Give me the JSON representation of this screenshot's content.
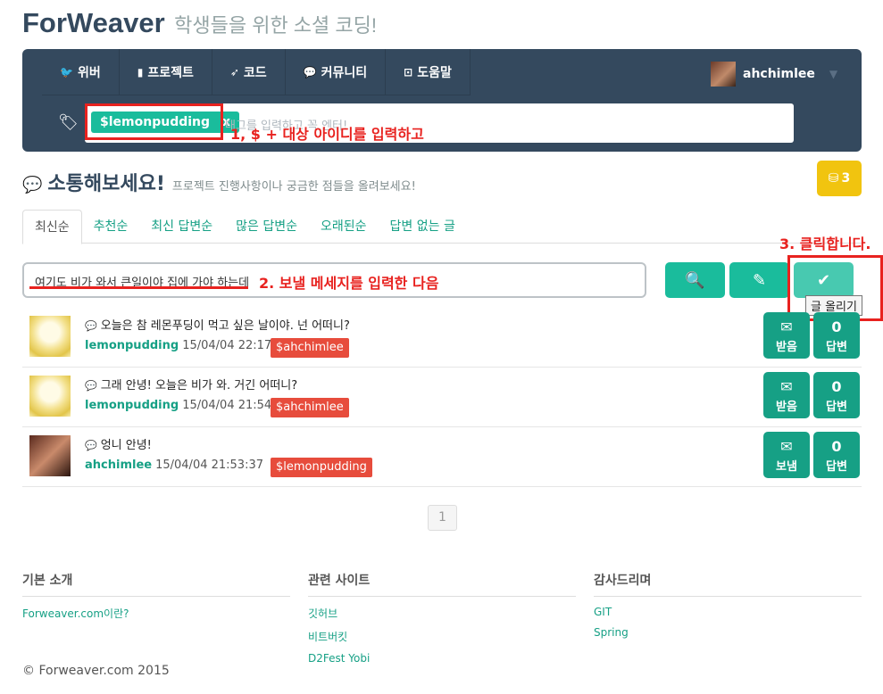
{
  "header": {
    "brand": "ForWeaver",
    "slogan": "학생들을 위한 소셜 코딩!"
  },
  "nav": {
    "items": [
      {
        "icon": "twitter-icon",
        "glyph": "🐦",
        "label": "위버"
      },
      {
        "icon": "bookmark-icon",
        "glyph": "▮",
        "label": "프로젝트"
      },
      {
        "icon": "rocket-icon",
        "glyph": "➶",
        "label": "코드"
      },
      {
        "icon": "comments-icon",
        "glyph": "💬",
        "label": "커뮤니티"
      },
      {
        "icon": "gamepad-icon",
        "glyph": "⊡",
        "label": "도움말"
      }
    ],
    "user": {
      "name": "ahchimlee",
      "caret": "▼"
    }
  },
  "tag_bar": {
    "chip_label": "$lemonpudding",
    "chip_close": "x",
    "placeholder": "태그를 입력하고 꼭 엔터!"
  },
  "annotations": {
    "step1": "1, $ + 대상 아이디를 입력하고",
    "step2": "2. 보낼 메세지를 입력한 다음",
    "step3": "3. 클릭합니다."
  },
  "section": {
    "title": "소통해보세요!",
    "subtitle": "프로젝트 진행사항이나 궁금한 점들을 올려보세요!",
    "coin_count": "3"
  },
  "tabs": [
    "최신순",
    "추천순",
    "최신 답변순",
    "많은 답변순",
    "오래된순",
    "답변 없는 글"
  ],
  "composer": {
    "message": "여기도 비가 와서 큰일이야 집에 가야 하는데",
    "tooltip": "글 올리기"
  },
  "posts": [
    {
      "text": "오늘은 참 레몬푸딩이 먹고 싶은 날이야. 넌 어떠니?",
      "author": "lemonpudding",
      "date": "15/04/04 22:17:27",
      "target": "$ahchimlee",
      "box_label": "받음",
      "reply_count": "0",
      "reply_label": "답변"
    },
    {
      "text": "그래 안녕! 오늘은 비가 와. 거긴 어떠니?",
      "author": "lemonpudding",
      "date": "15/04/04 21:54:28",
      "target": "$ahchimlee",
      "box_label": "받음",
      "reply_count": "0",
      "reply_label": "답변"
    },
    {
      "text": "엉니 안녕!",
      "author": "ahchimlee",
      "date": "15/04/04 21:53:37",
      "target": "$lemonpudding",
      "box_label": "보냄",
      "reply_count": "0",
      "reply_label": "답변"
    }
  ],
  "pagination": {
    "current": "1"
  },
  "footer": {
    "about": {
      "title": "기본 소개",
      "links": [
        "Forweaver.com이란?"
      ]
    },
    "related": {
      "title": "관련 사이트",
      "links": [
        "깃허브",
        "비트버킷",
        "D2Fest Yobi"
      ]
    },
    "thanks": {
      "title": "감사드리며",
      "links": [
        "GIT",
        "Spring"
      ]
    },
    "copyright": "© Forweaver.com 2015"
  },
  "colors": {
    "navy": "#34495e",
    "teal": "#1abc9c",
    "red": "#e74c3c",
    "yellow": "#f1c40f"
  }
}
